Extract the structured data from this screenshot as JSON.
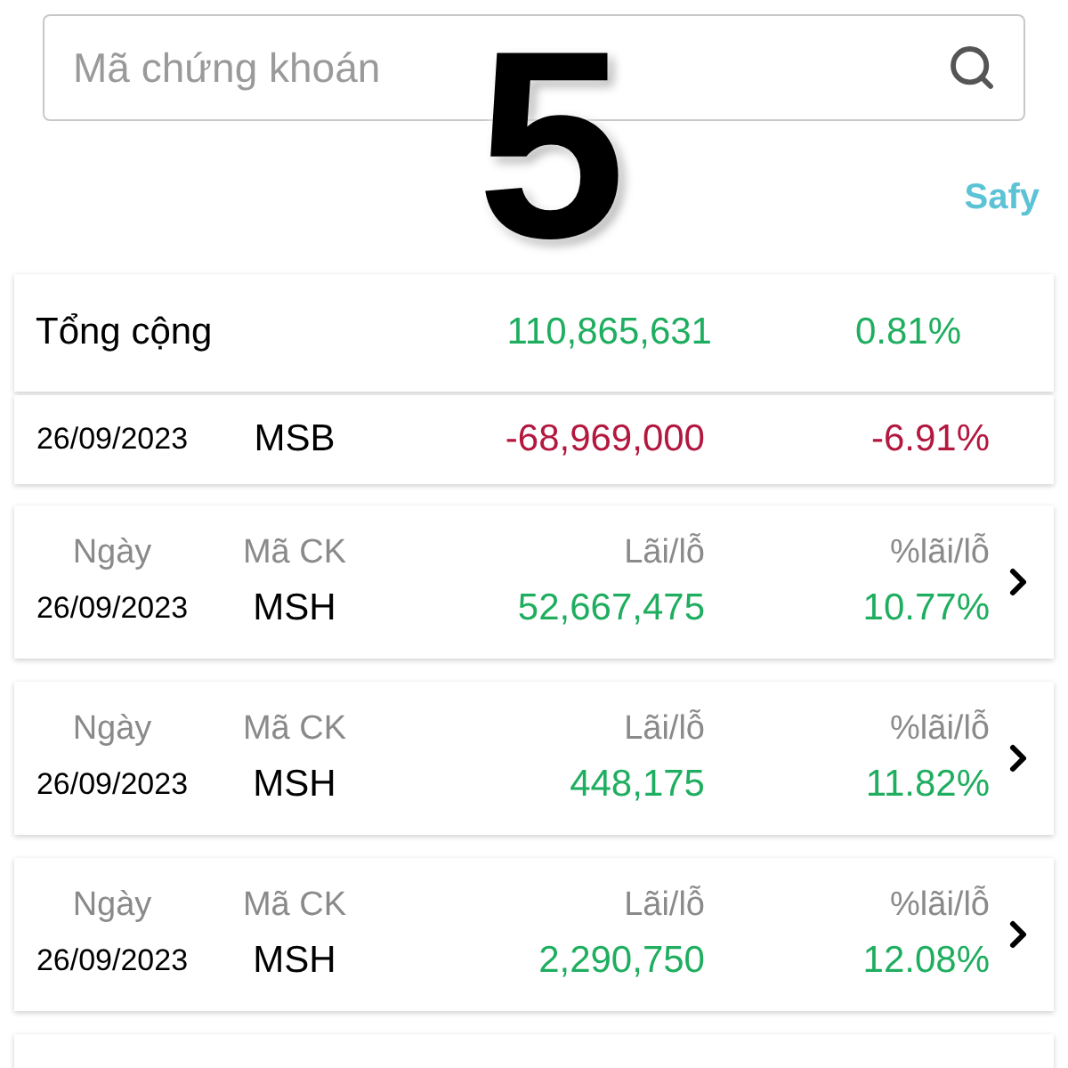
{
  "search": {
    "placeholder": "Mã chứng khoán"
  },
  "step_number": "5",
  "broker": "Safy",
  "total": {
    "label": "Tổng cộng",
    "profit": "110,865,631",
    "percent": "0.81%",
    "color": "#1fae5f"
  },
  "trades": [
    {
      "labels_visible": false,
      "color": "#b3183f",
      "date": "26/09/2023",
      "code": "MSB",
      "profit": "-68,969,000",
      "percent": "-6.91%",
      "chevron": false
    },
    {
      "labels_visible": true,
      "color": "#1fae5f",
      "date_label": "Ngày",
      "code_label": "Mã CK",
      "profit_label": "Lãi/lỗ",
      "percent_label": "%lãi/lỗ",
      "date": "26/09/2023",
      "code": "MSH",
      "profit": "52,667,475",
      "percent": "10.77%",
      "chevron": true
    },
    {
      "labels_visible": true,
      "color": "#1fae5f",
      "date_label": "Ngày",
      "code_label": "Mã CK",
      "profit_label": "Lãi/lỗ",
      "percent_label": "%lãi/lỗ",
      "date": "26/09/2023",
      "code": "MSH",
      "profit": "448,175",
      "percent": "11.82%",
      "chevron": true
    },
    {
      "labels_visible": true,
      "color": "#1fae5f",
      "date_label": "Ngày",
      "code_label": "Mã CK",
      "profit_label": "Lãi/lỗ",
      "percent_label": "%lãi/lỗ",
      "date": "26/09/2023",
      "code": "MSH",
      "profit": "2,290,750",
      "percent": "12.08%",
      "chevron": true
    }
  ]
}
